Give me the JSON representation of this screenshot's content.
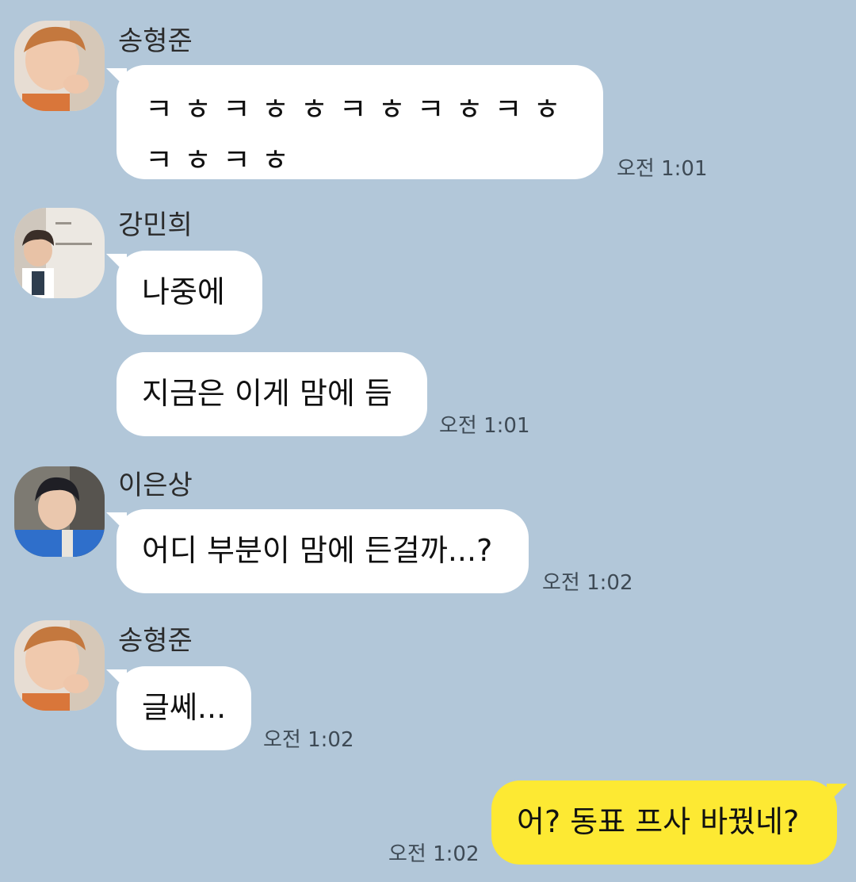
{
  "messages": [
    {
      "sender": "송형준",
      "avatar": "sender-avatar-song-hyungjun",
      "text": "ㅋㅎㅋㅎㅎㅋㅎㅋㅎㅋㅎㅋㅎㅋㅎ",
      "time": "오전 1:01"
    },
    {
      "sender": "강민희",
      "avatar": "sender-avatar-kang-minhee",
      "text": "나중에"
    },
    {
      "text": "지금은 이게 맘에 듬",
      "time": "오전 1:01"
    },
    {
      "sender": "이은상",
      "avatar": "sender-avatar-lee-eunsang",
      "text": "어디 부분이 맘에 든걸까...?",
      "time": "오전 1:02"
    },
    {
      "sender": "송형준",
      "avatar": "sender-avatar-song-hyungjun",
      "text": "글쎄...",
      "time": "오전 1:02"
    }
  ],
  "my_message": {
    "text": "어? 동표 프사 바꿨네?",
    "time": "오전 1:02"
  },
  "colors": {
    "background": "#b2c7d9",
    "incoming_bubble": "#ffffff",
    "outgoing_bubble": "#fde933"
  }
}
